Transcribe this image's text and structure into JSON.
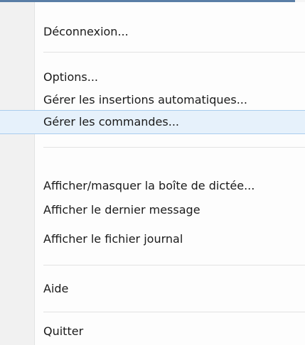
{
  "menu": {
    "items": [
      {
        "id": "deconnexion",
        "label": "Déconnexion..."
      },
      {
        "id": "options",
        "label": "Options..."
      },
      {
        "id": "gerer-insertions",
        "label": "Gérer les insertions automatiques..."
      },
      {
        "id": "gerer-commandes",
        "label": "Gérer les commandes..."
      },
      {
        "id": "afficher-masquer",
        "label": "Afficher/masquer la boîte de dictée..."
      },
      {
        "id": "afficher-dernier",
        "label": "Afficher le dernier message"
      },
      {
        "id": "afficher-journal",
        "label": "Afficher le fichier journal"
      },
      {
        "id": "aide",
        "label": "Aide"
      },
      {
        "id": "quitter",
        "label": "Quitter"
      }
    ],
    "highlighted_item": "Gérer les commandes..."
  },
  "colors": {
    "menu_background": "#fdfdfd",
    "gutter": "#f1f1f1",
    "highlight_fill": "#e6f1fb",
    "highlight_border": "#a9cdee",
    "separator": "#e2e2e2",
    "top_window_strip": "#5a7ea6"
  }
}
